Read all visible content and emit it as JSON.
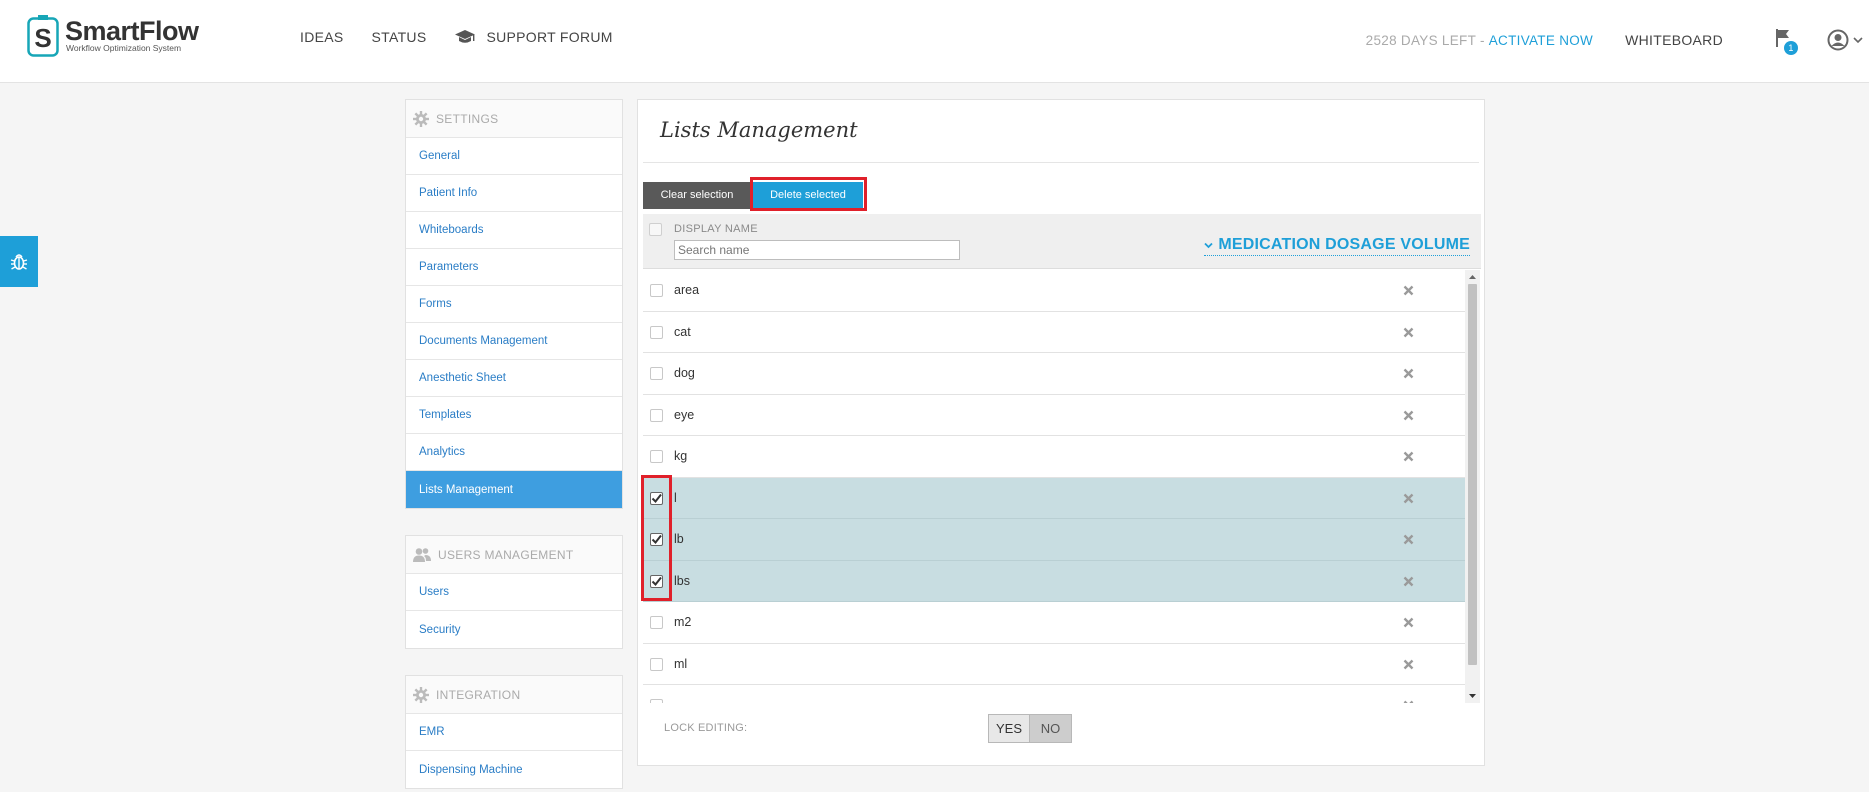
{
  "app": {
    "logo_title": "SmartFlow",
    "logo_subtitle": "Workflow Optimization System",
    "nav": [
      "IDEAS",
      "STATUS",
      "SUPPORT FORUM"
    ],
    "trial_text": "2528 DAYS LEFT -",
    "activate_label": "ACTIVATE NOW",
    "whiteboard_label": "WHITEBOARD",
    "notification_count": "1",
    "brand_color": "#1e9fd8"
  },
  "sidebar": {
    "settings": {
      "heading": "SETTINGS",
      "items": [
        "General",
        "Patient Info",
        "Whiteboards",
        "Parameters",
        "Forms",
        "Documents Management",
        "Anesthetic Sheet",
        "Templates",
        "Analytics",
        "Lists Management"
      ],
      "active": "Lists Management"
    },
    "users": {
      "heading": "USERS MANAGEMENT",
      "items": [
        "Users",
        "Security"
      ]
    },
    "integration": {
      "heading": "INTEGRATION",
      "items": [
        "EMR",
        "Dispensing Machine"
      ]
    }
  },
  "main": {
    "title": "Lists Management",
    "clear_label": "Clear selection",
    "delete_label": "Delete selected",
    "column_display": "DISPLAY NAME",
    "search_placeholder": "Search name",
    "list_selector": "MEDICATION DOSAGE VOLUME",
    "rows": [
      {
        "name": "area",
        "checked": false
      },
      {
        "name": "cat",
        "checked": false
      },
      {
        "name": "dog",
        "checked": false
      },
      {
        "name": "eye",
        "checked": false
      },
      {
        "name": "kg",
        "checked": false
      },
      {
        "name": "l",
        "checked": true
      },
      {
        "name": "lb",
        "checked": true
      },
      {
        "name": "lbs",
        "checked": true
      },
      {
        "name": "m2",
        "checked": false
      },
      {
        "name": "ml",
        "checked": false
      }
    ],
    "lock_label": "LOCK EDITING:",
    "yes_label": "YES",
    "no_label": "NO"
  }
}
